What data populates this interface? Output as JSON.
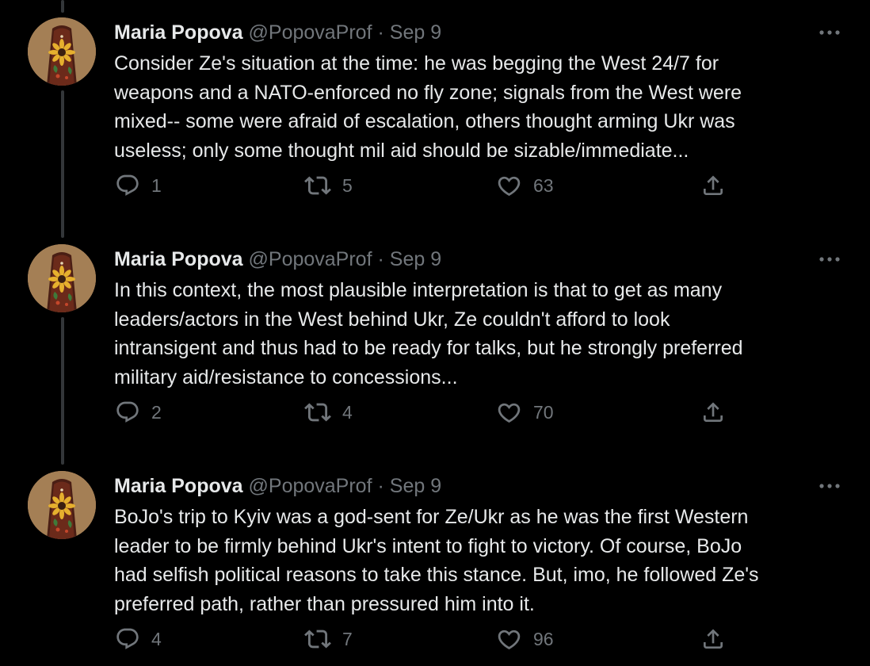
{
  "colors": {
    "background": "#000000",
    "primary_text": "#e7e9ea",
    "secondary_text": "#71767b",
    "thread_line": "#333639"
  },
  "icons": {
    "reply": "speech-bubble",
    "retweet": "retweet-arrows",
    "like": "heart",
    "share": "share-up-arrow",
    "more": "ellipsis"
  },
  "tweets": [
    {
      "author_name": "Maria Popova",
      "author_handle": "@PopovaProf",
      "separator": "·",
      "date": "Sep 9",
      "text_lines": [
        "Consider Ze's situation at the time: he was begging the West 24/7 for",
        "weapons and a NATO-enforced no fly zone; signals from the West were",
        "mixed-- some were afraid of escalation, others thought arming Ukr was",
        "useless; only some thought mil aid should be sizable/immediate..."
      ],
      "replies": "1",
      "retweets": "5",
      "likes": "63"
    },
    {
      "author_name": "Maria Popova",
      "author_handle": "@PopovaProf",
      "separator": "·",
      "date": "Sep 9",
      "text_lines": [
        "In this context, the most plausible interpretation is that to get as many",
        "leaders/actors in the West behind Ukr, Ze couldn't afford to look",
        "intransigent and thus had to be ready for talks, but he strongly preferred",
        "military aid/resistance to concessions..."
      ],
      "replies": "2",
      "retweets": "4",
      "likes": "70"
    },
    {
      "author_name": "Maria Popova",
      "author_handle": "@PopovaProf",
      "separator": "·",
      "date": "Sep 9",
      "text_lines": [
        "BoJo's trip to Kyiv was a god-sent for Ze/Ukr as he was the first Western",
        "leader to be firmly behind Ukr's intent to fight to victory. Of course, BoJo",
        "had selfish political reasons to take this stance. But, imo, he followed Ze's",
        "preferred path, rather than pressured him into it."
      ],
      "replies": "4",
      "retweets": "7",
      "likes": "96"
    }
  ]
}
